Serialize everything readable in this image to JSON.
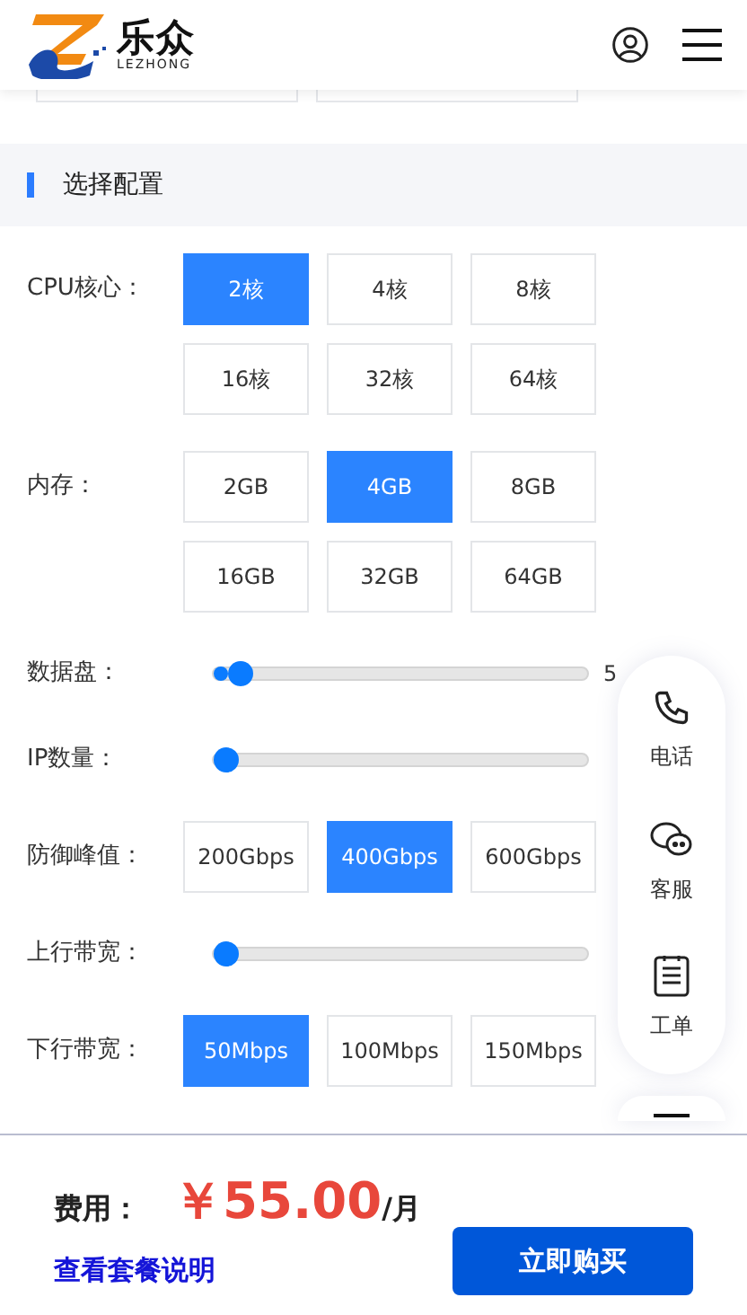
{
  "header": {
    "logo_text": "乐众",
    "logo_subtext": "LEZHONG"
  },
  "section": {
    "title": "选择配置"
  },
  "config_rows": [
    {
      "kind": "options",
      "label": "CPU核心：",
      "options": [
        {
          "label": "2核",
          "selected": true
        },
        {
          "label": "4核",
          "selected": false
        },
        {
          "label": "8核",
          "selected": false
        },
        {
          "label": "16核",
          "selected": false
        },
        {
          "label": "32核",
          "selected": false
        },
        {
          "label": "64核",
          "selected": false
        }
      ]
    },
    {
      "kind": "options",
      "label": "内存：",
      "options": [
        {
          "label": "2GB",
          "selected": false
        },
        {
          "label": "4GB",
          "selected": true
        },
        {
          "label": "8GB",
          "selected": false
        },
        {
          "label": "16GB",
          "selected": false
        },
        {
          "label": "32GB",
          "selected": false
        },
        {
          "label": "64GB",
          "selected": false
        }
      ]
    },
    {
      "kind": "slider",
      "label": "数据盘：",
      "level": 0.04,
      "reading": "5"
    },
    {
      "kind": "slider",
      "label": "IP数量：",
      "level": 0
    },
    {
      "kind": "options",
      "label": "防御峰值：",
      "options": [
        {
          "label": "200Gbps",
          "selected": false
        },
        {
          "label": "400Gbps",
          "selected": true
        },
        {
          "label": "600Gbps",
          "selected": false
        }
      ]
    },
    {
      "kind": "slider",
      "label": "上行带宽：",
      "level": 0
    },
    {
      "kind": "options",
      "label": "下行带宽：",
      "options": [
        {
          "label": "50Mbps",
          "selected": true
        },
        {
          "label": "100Mbps",
          "selected": false
        },
        {
          "label": "150Mbps",
          "selected": false
        }
      ]
    }
  ],
  "float_menu": [
    {
      "kind": "phone",
      "label": "电话"
    },
    {
      "kind": "chat",
      "label": "客服"
    },
    {
      "kind": "ticket",
      "label": "工单"
    }
  ],
  "footer": {
    "price_label": "费用：",
    "price": "￥55.00",
    "unit": "/月",
    "link": "查看套餐说明",
    "buy_button": "立即购买"
  }
}
